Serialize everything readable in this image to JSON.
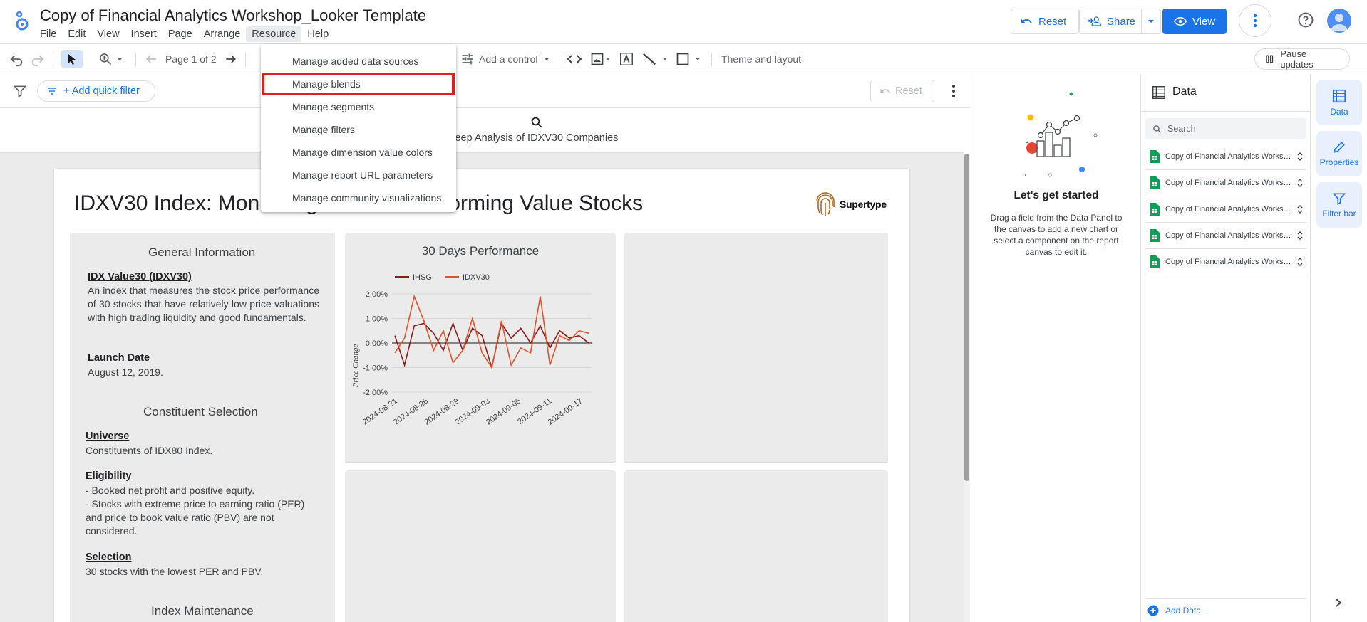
{
  "app": {
    "title": "Copy of Financial Analytics Workshop_Looker Template"
  },
  "menubar": {
    "items": [
      "File",
      "Edit",
      "View",
      "Insert",
      "Page",
      "Arrange",
      "Resource",
      "Help"
    ],
    "active": "Resource"
  },
  "header_actions": {
    "reset": "Reset",
    "share": "Share",
    "view": "View"
  },
  "toolbar": {
    "page_indicator": "Page 1 of 2",
    "add_control": "Add a control",
    "theme_layout": "Theme and layout",
    "pause_updates": "Pause updates"
  },
  "filterbar": {
    "quick_filter": "+ Add quick filter",
    "reset": "Reset"
  },
  "resource_menu": {
    "items": [
      "Manage added data sources",
      "Manage blends",
      "Manage segments",
      "Manage filters",
      "Manage dimension value colors",
      "Manage report URL parameters",
      "Manage community visualizations"
    ],
    "highlighted": "Manage blends"
  },
  "report": {
    "header_subtitle": "Deep Analysis of IDXV30 Companies",
    "title": "IDXV30 Index: Monitoring the Best-Performing Value Stocks",
    "brand": "Supertype",
    "general_info": {
      "heading": "General Information",
      "index_label": "IDX Value30 (IDXV30)",
      "index_text": "An index that measures the stock price performance of 30 stocks that have relatively low price valuations with high trading liquidity and good fundamentals.",
      "launch_label": "Launch Date",
      "launch_text": "August 12, 2019."
    },
    "constituent": {
      "heading": "Constituent Selection",
      "universe_label": "Universe",
      "universe_text": "Constituents of IDX80 Index.",
      "eligibility_label": "Eligibility",
      "eligibility_line1": "- Booked net profit and positive equity.",
      "eligibility_line2": "- Stocks with extreme price to earning ratio (PER) and price to book value ratio (PBV) are not considered.",
      "selection_label": "Selection",
      "selection_text": "30 stocks with the lowest PER and PBV."
    },
    "maintenance": {
      "heading": "Index Maintenance"
    }
  },
  "chart_data": {
    "type": "line",
    "title": "30 Days Performance",
    "ylabel": "Price Change",
    "xlabel": "",
    "ylim": [
      -2.0,
      2.0
    ],
    "yticks": [
      "2.00%",
      "1.00%",
      "0.00%",
      "-1.00%",
      "-2.00%"
    ],
    "xticks": [
      "2024-08-21",
      "2024-08-26",
      "2024-08-29",
      "2024-09-03",
      "2024-09-06",
      "2024-09-11",
      "2024-09-17"
    ],
    "legend_position": "top",
    "series": [
      {
        "name": "IHSG",
        "color": "#8b1a1a",
        "values": [
          0.3,
          -0.9,
          0.7,
          0.8,
          0.4,
          -0.3,
          0.8,
          -0.3,
          0.6,
          0.3,
          -1.0,
          0.8,
          0.2,
          0.6,
          0.0,
          0.7,
          -0.2,
          0.5,
          0.2,
          0.3,
          0.0
        ]
      },
      {
        "name": "IDXV30",
        "color": "#e0542a",
        "values": [
          -0.4,
          0.2,
          1.9,
          0.9,
          -0.3,
          0.5,
          -0.8,
          -0.3,
          1.0,
          -0.4,
          -1.0,
          0.9,
          -0.9,
          -0.2,
          -0.4,
          1.9,
          -0.9,
          0.3,
          0.1,
          0.5,
          0.4
        ]
      }
    ]
  },
  "getting_started": {
    "title": "Let's get started",
    "text": "Drag a field from the Data Panel to the canvas to add a new chart or select a component on the report canvas to edit it."
  },
  "data_panel": {
    "title": "Data",
    "search_placeholder": "Search",
    "sources": [
      "Copy of Financial Analytics Workshop_Looker Template",
      "Copy of Financial Analytics Workshop_Looker Template",
      "Copy of Financial Analytics Workshop_Looker Template",
      "Copy of Financial Analytics Workshop_Looker Template",
      "Copy of Financial Analytics Workshop_Looker Template"
    ],
    "add_data": "Add Data"
  },
  "rail": {
    "items": [
      "Data",
      "Properties",
      "Filter bar"
    ]
  },
  "colors": {
    "accent": "#1a73e8",
    "highlight_box": "#e01e1e",
    "sheets_green": "#0f9d58"
  }
}
